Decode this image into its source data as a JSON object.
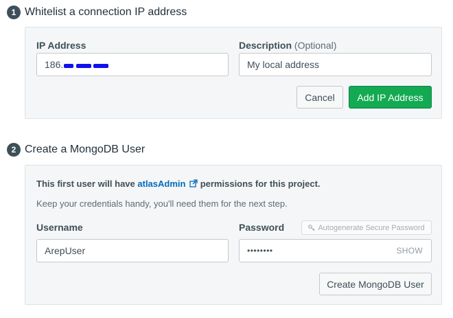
{
  "step1": {
    "number": "1",
    "title": "Whitelist a connection IP address",
    "ip_label": "IP Address",
    "ip_value_prefix": "186.",
    "desc_label": "Description",
    "desc_optional": "(Optional)",
    "desc_value": "My local address",
    "cancel_label": "Cancel",
    "add_label": "Add IP Address"
  },
  "step2": {
    "number": "2",
    "title": "Create a MongoDB User",
    "info_pre": "This first user will have ",
    "info_link": "atlasAdmin",
    "info_post": " permissions for this project.",
    "info_sub": "Keep your credentials handy, you'll need them for the next step.",
    "username_label": "Username",
    "username_value": "ArepUser",
    "password_label": "Password",
    "password_value": "••••••••",
    "autogen_label": "Autogenerate Secure Password",
    "show_label": "SHOW",
    "create_label": "Create MongoDB User"
  },
  "colors": {
    "primary_green": "#13aa52",
    "link_blue": "#006cbc",
    "panel_bg": "#f5f6f7"
  },
  "icons": [
    "external-link-icon",
    "key-icon"
  ]
}
